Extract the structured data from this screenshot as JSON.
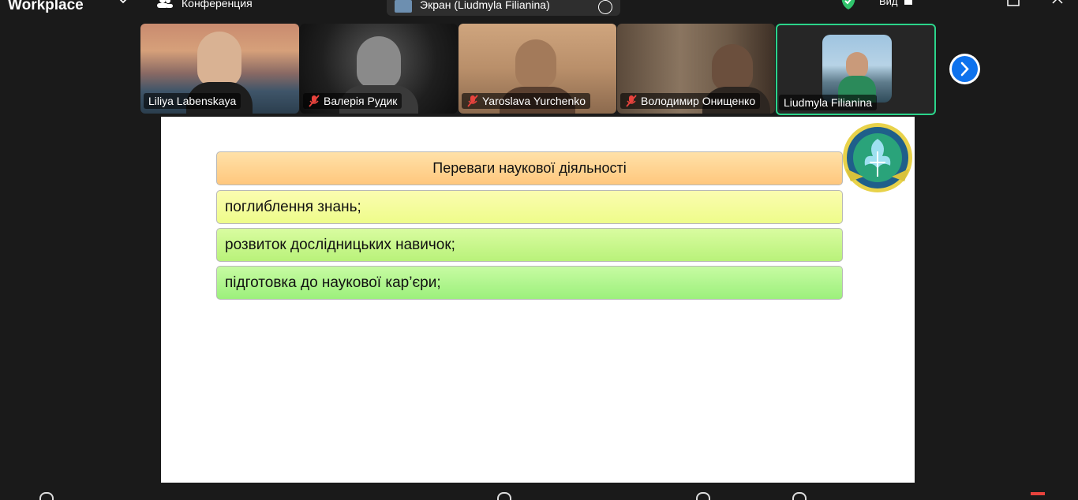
{
  "app": {
    "name": "Workplace"
  },
  "header": {
    "conference_label": "Конференция",
    "share_label": "Экран (Liudmyla Filianina)",
    "view_label": "Вид"
  },
  "participants": [
    {
      "name": "Liliya Labenskaya",
      "muted": false
    },
    {
      "name": "Валерія Рудик",
      "muted": true
    },
    {
      "name": "Yaroslava Yurchenko",
      "muted": true
    },
    {
      "name": "Володимир Онищенко",
      "muted": true
    },
    {
      "name": "Liudmyla Filianina",
      "muted": false,
      "active_speaker": true
    }
  ],
  "slide": {
    "title": "Переваги наукової діяльності",
    "items": [
      "поглиблення знань;",
      "розвиток дослідницьких навичок;",
      "підготовка до наукової кар’єри;"
    ]
  },
  "colors": {
    "active_border": "#2bd48a",
    "accent_blue": "#0e72ed",
    "shield_green": "#2fc46b"
  },
  "icons": [
    "chevron-down-icon",
    "conference-icon",
    "more-icon",
    "shield-icon",
    "popout-icon",
    "close-icon",
    "mic-muted-icon",
    "next-arrow-icon",
    "logo-emblem"
  ]
}
